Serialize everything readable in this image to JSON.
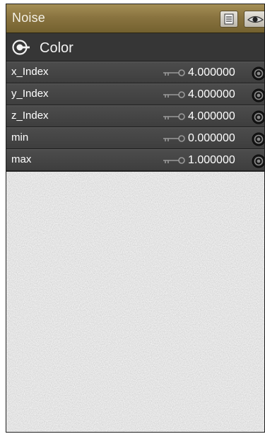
{
  "node": {
    "title": "Noise",
    "section_label": "Color",
    "params": [
      {
        "name": "x_Index",
        "value": "4.000000"
      },
      {
        "name": "y_Index",
        "value": "4.000000"
      },
      {
        "name": "z_Index",
        "value": "4.000000"
      },
      {
        "name": "min",
        "value": "0.000000"
      },
      {
        "name": "max",
        "value": "1.000000"
      }
    ]
  },
  "icons": {
    "title_buttons": [
      "list-icon",
      "eye-icon"
    ],
    "section": "target-circle-icon",
    "param_key": "key-icon",
    "param_port": "port-icon"
  },
  "colors": {
    "title_bar": "#8a7440",
    "panel": "#3a3a3a",
    "preview_noise": "#bdbdbd"
  }
}
